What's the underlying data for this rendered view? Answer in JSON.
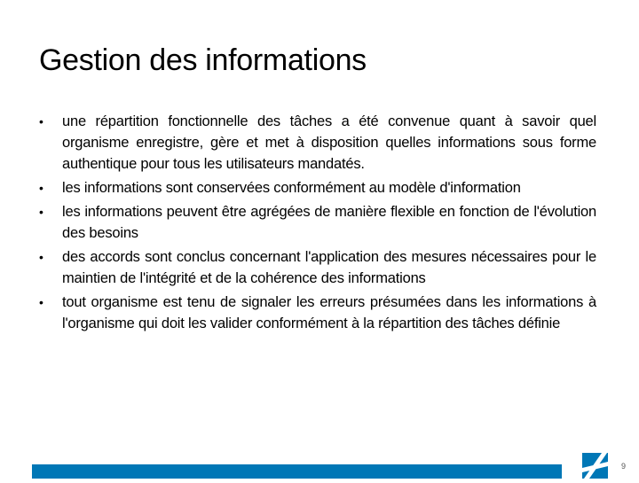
{
  "slide": {
    "title": "Gestion des informations",
    "bullets": [
      {
        "text": "une répartition fonctionnelle des tâches a été convenue quant à savoir quel organisme enregistre, gère et met à disposition quelles informations sous forme authentique pour tous les utilisateurs mandatés."
      },
      {
        "text": "les informations sont conservées conformément au modèle d'information"
      },
      {
        "text": "les informations peuvent être agrégées de manière flexible en fonction de l'évolution des besoins"
      },
      {
        "text": "des accords sont conclus concernant l'application des mesures nécessaires pour le maintien de l'intégrité et de la cohérence des informations"
      },
      {
        "text": "tout organisme est tenu de signaler les erreurs présumées dans les informations à l'organisme qui doit les valider conformément à la répartition des tâches définie"
      }
    ],
    "bullet_glyph": "•"
  },
  "footer": {
    "page_number": "9",
    "logo_icon": "flag-saltire-logo-icon",
    "accent_color": "#0077b6"
  }
}
